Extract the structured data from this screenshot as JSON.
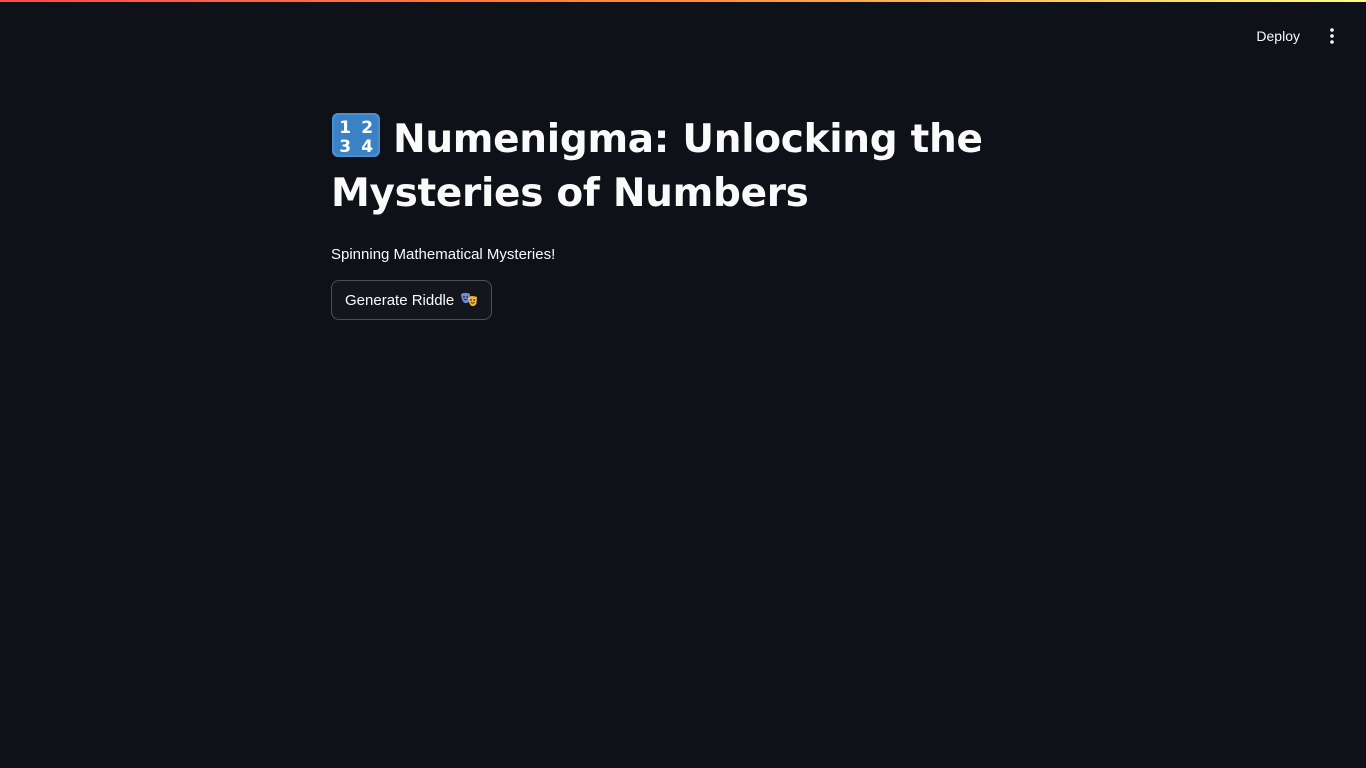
{
  "header": {
    "deploy_label": "Deploy",
    "menu_icon": "kebab-menu-icon"
  },
  "main": {
    "title_icon": "numbers-keycap-icon",
    "title_text": "Numenigma: Unlocking the Mysteries of Numbers",
    "subtitle": "Spinning Mathematical Mysteries!",
    "button_label": "Generate Riddle",
    "button_icon": "performing-arts-masks-icon"
  },
  "colors": {
    "background": "#0e1117",
    "text": "#fafafa",
    "accent_gradient_start": "#ff4b4b",
    "accent_gradient_end": "#fffd80",
    "keycap_blue": "#3b82c4"
  }
}
